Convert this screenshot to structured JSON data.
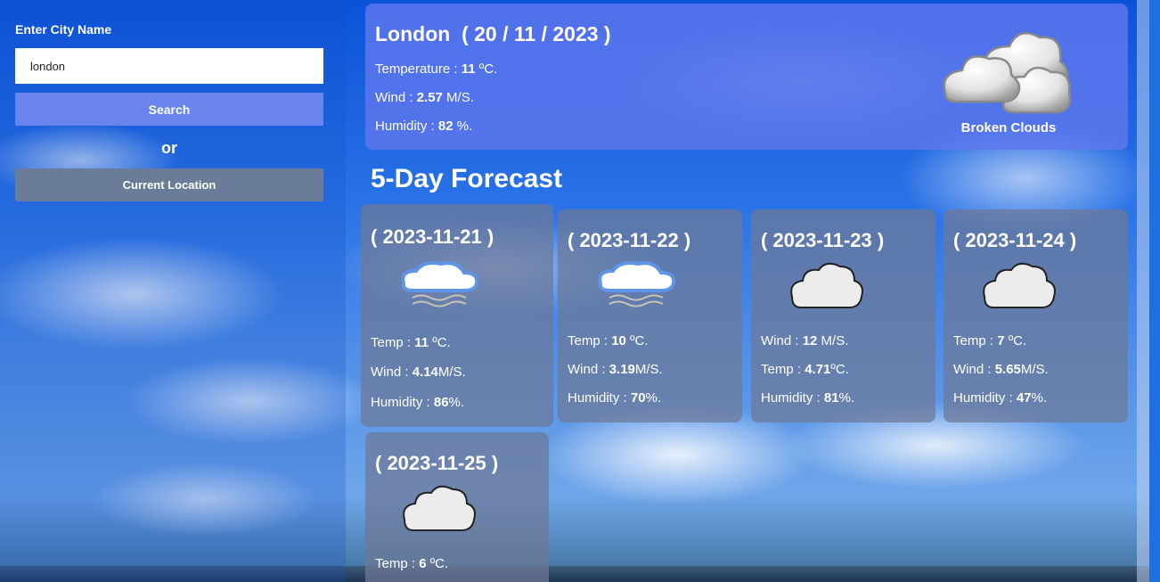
{
  "sidebar": {
    "city_label": "Enter City Name",
    "city_input_value": "london",
    "search_label": "Search",
    "or_label": "or",
    "current_location_label": "Current Location"
  },
  "current": {
    "title": "London  ( 20 / 11 / 2023 )",
    "temp_prefix": "Temperature : ",
    "temp_value": "11",
    "temp_unit": " ºC.",
    "wind_prefix": "Wind : ",
    "wind_value": "2.57",
    "wind_unit": " M/S.",
    "humidity_prefix": "Humidity : ",
    "humidity_value": "82",
    "humidity_unit": " %.",
    "icon": "broken-clouds-icon",
    "description": "Broken Clouds"
  },
  "forecast_title": "5-Day Forecast",
  "forecast": [
    {
      "date": "( 2023-11-21 )",
      "icon": "mist-cloud-icon",
      "l1_prefix": "Temp : ",
      "l1_value": "11",
      "l1_unit": " ºC.",
      "l2_prefix": "Wind : ",
      "l2_value": "4.14",
      "l2_unit": "M/S.",
      "l3_prefix": "Humidity : ",
      "l3_value": "86",
      "l3_unit": "%."
    },
    {
      "date": "( 2023-11-22 )",
      "icon": "mist-cloud-icon",
      "l1_prefix": "Temp : ",
      "l1_value": "10",
      "l1_unit": " ºC.",
      "l2_prefix": "Wind : ",
      "l2_value": "3.19",
      "l2_unit": "M/S.",
      "l3_prefix": "Humidity : ",
      "l3_value": "70",
      "l3_unit": "%."
    },
    {
      "date": "( 2023-11-23 )",
      "icon": "cloud-icon",
      "l1_prefix": "Wind : ",
      "l1_value": "12",
      "l1_unit": " M/S.",
      "l2_prefix": "Temp : ",
      "l2_value": "4.71",
      "l2_unit": "ºC.",
      "l3_prefix": "Humidity : ",
      "l3_value": "81",
      "l3_unit": "%."
    },
    {
      "date": "( 2023-11-24 )",
      "icon": "cloud-icon",
      "l1_prefix": "Temp : ",
      "l1_value": "7",
      "l1_unit": " ºC.",
      "l2_prefix": "Wind : ",
      "l2_value": "5.65",
      "l2_unit": "M/S.",
      "l3_prefix": "Humidity : ",
      "l3_value": "47",
      "l3_unit": "%."
    },
    {
      "date": "( 2023-11-25 )",
      "icon": "cloud-icon",
      "l1_prefix": "Temp : ",
      "l1_value": "6",
      "l1_unit": " ºC."
    }
  ]
}
